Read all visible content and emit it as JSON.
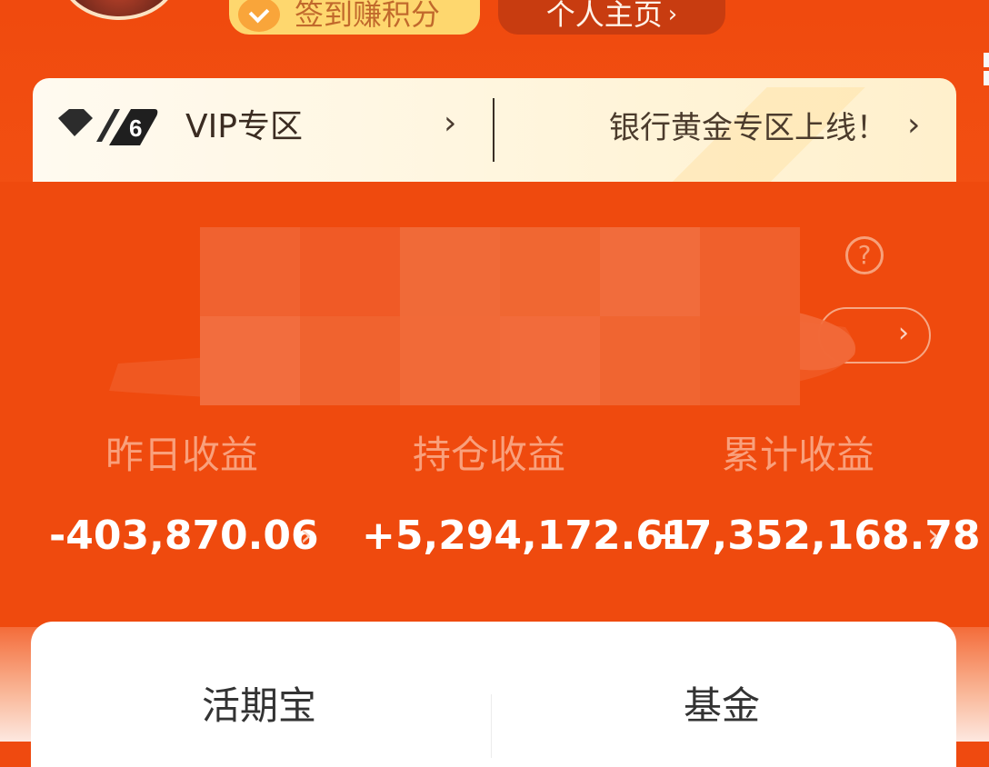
{
  "header": {
    "sign_in_label": "签到赚积分",
    "profile_label": "个人主页",
    "profile_chevron": "›"
  },
  "vip": {
    "level": "6",
    "label": "VIP专区",
    "chevron": "›",
    "gold_promo": "银行黄金专区上线！",
    "gold_chevron": "›"
  },
  "assets": {
    "help_symbol": "?",
    "detail_chevron": "›",
    "stats": [
      {
        "label": "昨日收益",
        "value": "-403,870.06",
        "chevron": "›"
      },
      {
        "label": "持仓收益",
        "value": "+5,294,172.61"
      },
      {
        "label": "累计收益",
        "value": "+7,352,168.78",
        "chevron": "›"
      }
    ]
  },
  "products": {
    "left": "活期宝",
    "right": "基金"
  },
  "colors": {
    "brand_orange": "#ef4a0e",
    "vip_gold": "#fff6df",
    "sign_yellow": "#fed76e",
    "profile_btn": "#c83c10",
    "stat_label": "#f9a07c",
    "stat_value": "#ffffff",
    "card_white": "#ffffff"
  },
  "icons": {
    "avatar": "avatar",
    "sign_in": "check-coin-icon",
    "vip_badge": "diamond-icon",
    "help": "question-icon",
    "chevron": "chevron-right-icon"
  }
}
